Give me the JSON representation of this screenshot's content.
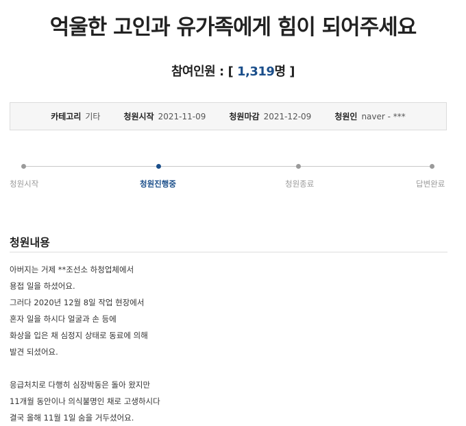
{
  "petition": {
    "title": "억울한 고인과 유가족에게 힘이 되어주세요",
    "participants_label": "참여인원",
    "participants_colon": ":",
    "participants_open": "[",
    "participants_count": "1,319",
    "participants_unit": "명",
    "participants_close": "]"
  },
  "info": {
    "category_label": "카테고리",
    "category_value": "기타",
    "start_label": "청원시작",
    "start_value": "2021-11-09",
    "end_label": "청원마감",
    "end_value": "2021-12-09",
    "author_label": "청원인",
    "author_value": "naver - ***"
  },
  "progress": {
    "current_step": 1,
    "steps": [
      {
        "label": "청원시작"
      },
      {
        "label": "청원진행중"
      },
      {
        "label": "청원종료"
      },
      {
        "label": "답변완료"
      }
    ]
  },
  "content": {
    "section_title": "청원내용",
    "paragraph1": [
      "아버지는 거제 **조선소 하청업체에서",
      "용접 일을 하셨어요.",
      "그러다 2020년 12월 8일 작업 현장에서",
      "혼자 일을 하시다 얼굴과 손 등에",
      "화상을 입은 채 심정지 상태로 동료에 의해",
      "발견 되셨어요."
    ],
    "paragraph2": [
      "응급처치로 다행히 심장박동은 돌아 왔지만",
      "11개월 동안이나 의식불명인 채로 고생하시다",
      "결국 올해 11월 1일 숨을 거두셨어요."
    ]
  },
  "colors": {
    "accent": "#1a4e8a",
    "info_bg": "#f6f6f6",
    "inactive": "#9a9a9a"
  }
}
